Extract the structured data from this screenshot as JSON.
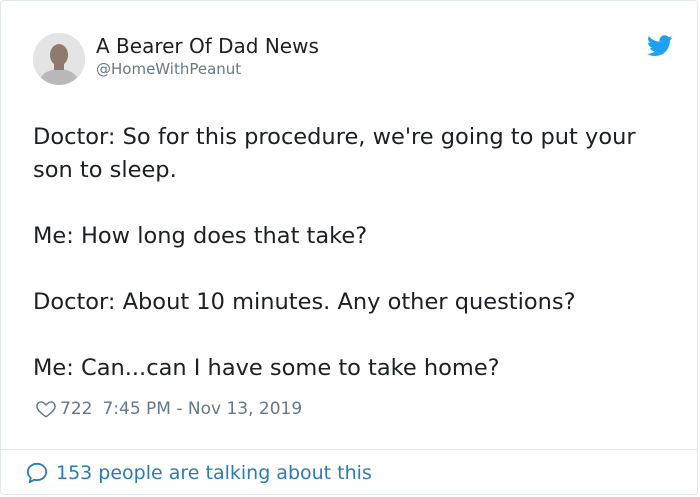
{
  "author": {
    "display_name": "A Bearer Of Dad News",
    "handle": "@HomeWithPeanut",
    "avatar_icon": "user-avatar"
  },
  "brand": {
    "icon": "twitter-bird-icon",
    "color": "#1da1f2"
  },
  "tweet": {
    "paragraphs": [
      "Doctor: So for this procedure, we're going to put your son to sleep.",
      "Me: How long does that take?",
      "Doctor: About 10 minutes. Any other questions?",
      "Me: Can...can I have some to take home?"
    ]
  },
  "meta": {
    "like_icon": "heart-icon",
    "like_count": "722",
    "timestamp": "7:45 PM - Nov 13, 2019"
  },
  "footer": {
    "icon": "speech-bubble-icon",
    "label": "153 people are talking about this",
    "link_color": "#2b7bb9"
  }
}
